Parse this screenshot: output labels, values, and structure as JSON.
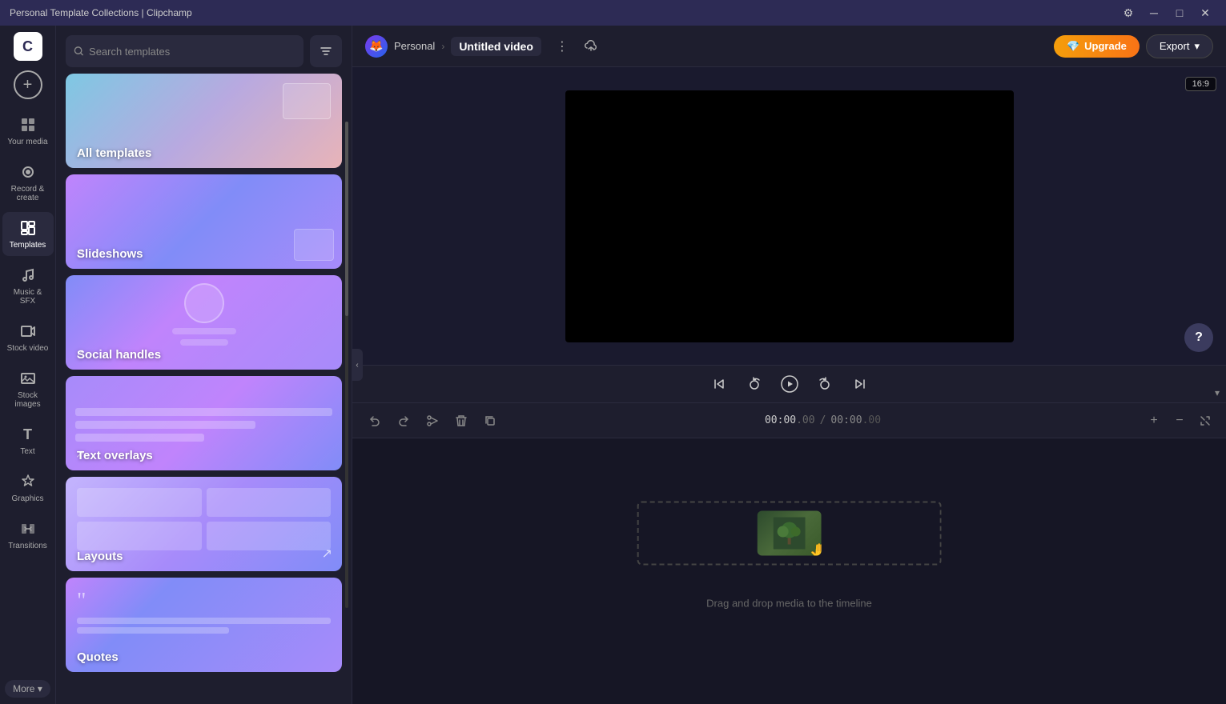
{
  "app": {
    "title": "Personal Template Collections | Clipchamp",
    "logo": "C"
  },
  "titlebar": {
    "title": "Personal Template Collections | Clipchamp",
    "buttons": {
      "settings": "⚙",
      "minimize": "─",
      "maximize": "□",
      "close": "✕"
    }
  },
  "sidebar": {
    "logo": "C",
    "add_label": "+",
    "items": [
      {
        "id": "your-media",
        "label": "Your media",
        "icon": "▦"
      },
      {
        "id": "record-create",
        "label": "Record & create",
        "icon": "◉"
      },
      {
        "id": "templates",
        "label": "Templates",
        "icon": "⊞",
        "active": true
      },
      {
        "id": "music-sfx",
        "label": "Music & SFX",
        "icon": "♪"
      },
      {
        "id": "stock-video",
        "label": "Stock video",
        "icon": "▶"
      },
      {
        "id": "stock-images",
        "label": "Stock images",
        "icon": "🖼"
      },
      {
        "id": "text",
        "label": "Text",
        "icon": "T"
      },
      {
        "id": "graphics",
        "label": "Graphics",
        "icon": "✦"
      },
      {
        "id": "transitions",
        "label": "Transitions",
        "icon": "⇄"
      }
    ],
    "more_label": "More ▾"
  },
  "templates_panel": {
    "search_placeholder": "Search templates",
    "filter_icon": "≡",
    "cards": [
      {
        "id": "all-templates",
        "label": "All templates",
        "bg": "all-templates"
      },
      {
        "id": "slideshows",
        "label": "Slideshows",
        "bg": "slideshows"
      },
      {
        "id": "social-handles",
        "label": "Social handles",
        "bg": "social-handles"
      },
      {
        "id": "text-overlays",
        "label": "Text overlays",
        "bg": "text-overlays"
      },
      {
        "id": "layouts",
        "label": "Layouts",
        "bg": "layouts"
      },
      {
        "id": "quotes",
        "label": "Quotes",
        "bg": "quotes"
      }
    ]
  },
  "editor": {
    "breadcrumb_workspace": "Personal",
    "video_title": "Untitled video",
    "aspect_ratio": "16:9",
    "upgrade_label": "Upgrade",
    "export_label": "Export",
    "export_arrow": "▾"
  },
  "playback": {
    "skip_back": "⏮",
    "rewind": "↺",
    "play": "▶",
    "forward": "↻",
    "skip_forward": "⏭"
  },
  "timeline": {
    "undo_label": "↩",
    "redo_label": "↪",
    "cut_label": "✂",
    "delete_label": "🗑",
    "duplicate_label": "⊡",
    "time_current": "00:00",
    "time_current_ms": ".00",
    "time_separator": "/",
    "time_total": "00:00",
    "time_total_ms": ".00",
    "zoom_in": "+",
    "zoom_out": "−",
    "expand": "⤢",
    "drop_text": "Drag and drop media to the timeline",
    "chevron": "▾"
  },
  "colors": {
    "accent_purple": "#7c3aed",
    "accent_blue": "#2563eb",
    "bg_dark": "#1e1e2e",
    "bg_darker": "#161625",
    "titlebar": "#2d2b55",
    "upgrade_start": "#f59e0b",
    "upgrade_end": "#f97316"
  }
}
